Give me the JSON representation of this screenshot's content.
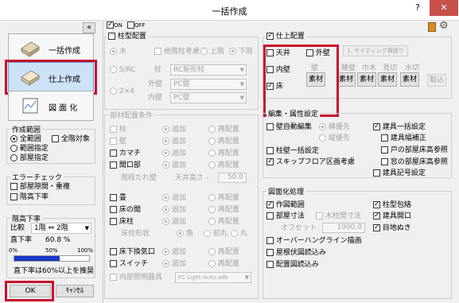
{
  "window": {
    "title": "一括作成",
    "help": "?",
    "close": "✕"
  },
  "toolbar": {
    "all_on": "ON",
    "all_off": "OFF"
  },
  "left": {
    "collapse": "«",
    "bulk_create": "一括作成",
    "finish_create": "仕上作成",
    "drawing": "図 面 化",
    "range": {
      "title": "作成範囲",
      "all_range": "全範囲",
      "all_target": "全階対象",
      "range_spec": "範囲指定",
      "floor_spec": "部屋指定"
    },
    "error": {
      "title": "エラーチェック",
      "gap_overlap": "部屋隙間・重複",
      "ceiling_low": "階高下率"
    },
    "ratio": {
      "title": "階高下率",
      "compare_label": "比較",
      "compare_value": "1階 ⇔ 2階",
      "rate_label": "直下率",
      "rate_value": "60.8 %",
      "scale": [
        "0%",
        "50%",
        "100%"
      ],
      "progress": 0.608,
      "note": "直下率は60%以上を推奨"
    },
    "ok": "OK",
    "cancel": "ｷｬﾝｾﾙ"
  },
  "col_cfg": {
    "title": "柱型配置",
    "wood": "木",
    "other_floor": "他階柱考慮",
    "upper": "上階",
    "lower": "下階",
    "src": "S/RC",
    "pillar_label": "柱",
    "pillar_value": "RC矩形柱",
    "ext_label": "外壁",
    "ext_value": "PC壁",
    "int_label": "内壁",
    "int_value": "PC壁",
    "twobyfour": "2×4"
  },
  "parts": {
    "title": "部材配置条件",
    "rows": [
      {
        "label": "柱",
        "opt1": "追加",
        "opt2": "再配置",
        "enabled": false,
        "checked": false
      },
      {
        "label": "壁",
        "opt1": "追加",
        "opt2": "再配置",
        "enabled": false,
        "checked": false
      },
      {
        "label": "カマチ",
        "opt1": "追加",
        "opt2": "再配置",
        "enabled": true,
        "checked": false
      },
      {
        "label": "間口部",
        "opt1": "追加",
        "opt2": "再配置",
        "enabled": true,
        "checked": false
      }
    ],
    "wall_height_label": "階段たれ壁",
    "ceiling_height_label": "天井高さ -",
    "ceiling_height_value": "50.0",
    "rows2": [
      {
        "label": "畳",
        "opt1": "追加",
        "opt2": "再配置",
        "enabled": true,
        "checked": false
      },
      {
        "label": "床の間",
        "opt1": "追加",
        "opt2": "再配置",
        "enabled": true,
        "checked": false
      },
      {
        "label": "床柱",
        "opt1": "追加",
        "opt2": "再配置",
        "enabled": true,
        "checked": false
      }
    ],
    "shape_label": "床柱形状",
    "shape_opts": [
      "角",
      "前丸",
      "丸"
    ],
    "rows3": [
      {
        "label": "床下換気口",
        "opt1": "追加",
        "opt2": "再配置",
        "enabled": true,
        "checked": false
      },
      {
        "label": "スイッチ",
        "opt1": "追加",
        "opt2": "再配置",
        "enabled": true,
        "checked": false
      }
    ],
    "lighting_label": "内部照明器具",
    "lighting_value": "FC Light-Auto.adb"
  },
  "finish": {
    "title": "仕上配置",
    "ceiling": "天井",
    "inner_wall": "内壁",
    "floor": "床",
    "outer_wall": "外壁",
    "siding": "1. サイディング横張り",
    "material": "素材",
    "headers": [
      "壁",
      "腰壁",
      "巾木",
      "見切",
      "水切"
    ],
    "fetch": "取込"
  },
  "edit": {
    "title": "編集・属性設定",
    "wall_auto": "壁自動編集",
    "horizontal": "横優先",
    "vertical": "縦優先",
    "fixture_bulk": "建具一括設定",
    "fixture_width": "建具幅補正",
    "pillar_wall": "柱壁一括設定",
    "door_room": "戸の部屋床高参照",
    "skip_floor": "スキップフロア区画考慮",
    "window_room": "窓の部屋床高参照",
    "fixture_code": "建具記号設定"
  },
  "draw": {
    "title": "図面化処理",
    "make_range": "作図範囲",
    "pillar_box": "柱型包絡",
    "room_dim": "部屋寸法",
    "pillar_dim": "木柱間寸法",
    "fixture_open": "建具開口",
    "offset_label": "オフセット",
    "offset_value": "1000.0",
    "eye_line": "目地ぬき",
    "overhang": "オーバーハングライン描画",
    "roof_plan": "屋根伏図読込み",
    "layout_plan": "配置図読込み"
  }
}
